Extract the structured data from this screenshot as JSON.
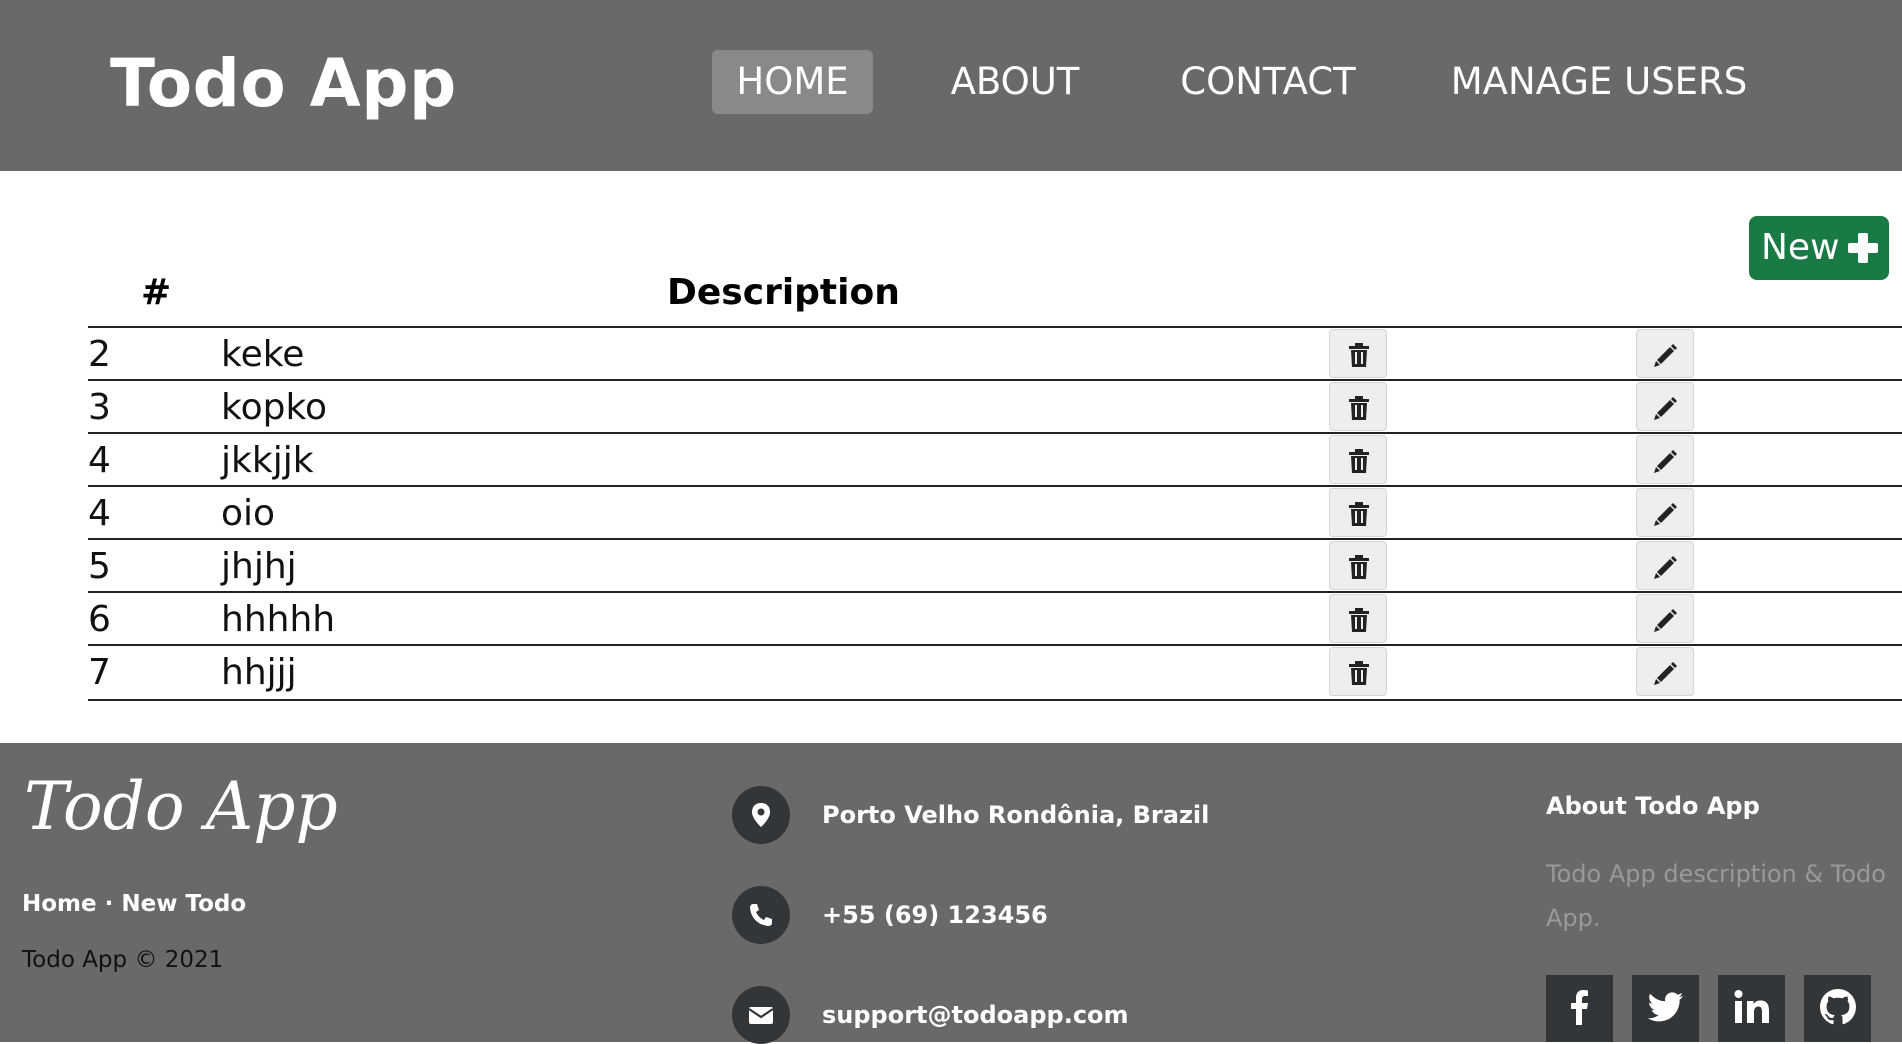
{
  "header": {
    "brand": "Todo App",
    "nav": [
      {
        "label": "HOME",
        "active": true
      },
      {
        "label": "ABOUT",
        "active": false
      },
      {
        "label": "CONTACT",
        "active": false
      },
      {
        "label": "MANAGE USERS",
        "active": false
      }
    ]
  },
  "main": {
    "new_button_label": "New",
    "columns": {
      "num": "#",
      "description": "Description"
    },
    "rows": [
      {
        "num": "2",
        "description": "keke"
      },
      {
        "num": "3",
        "description": "kopko"
      },
      {
        "num": "4",
        "description": "jkkjjk"
      },
      {
        "num": "4",
        "description": "oio"
      },
      {
        "num": "5",
        "description": "jhjhj"
      },
      {
        "num": "6",
        "description": "hhhhh"
      },
      {
        "num": "7",
        "description": "hhjjj"
      }
    ],
    "row_icons": {
      "delete": "trash-icon",
      "edit": "pencil-icon"
    }
  },
  "footer": {
    "brand": "Todo App",
    "links": {
      "home": "Home",
      "separator": " · ",
      "new_todo": "New Todo"
    },
    "copyright": "Todo App © 2021",
    "contact": {
      "address": "Porto Velho Rondônia, Brazil",
      "phone": "+55 (69) 123456",
      "email": "support@todoapp.com"
    },
    "about": {
      "title": "About Todo App",
      "text": "Todo App description & Todo App."
    },
    "social": [
      "facebook-icon",
      "twitter-icon",
      "linkedin-icon",
      "github-icon"
    ]
  },
  "colors": {
    "header_bg": "#6b6968",
    "nav_active_bg": "#8a898a",
    "new_button_bg": "#197a46",
    "icon_circle_bg": "#333638",
    "about_text": "#9a9899"
  }
}
